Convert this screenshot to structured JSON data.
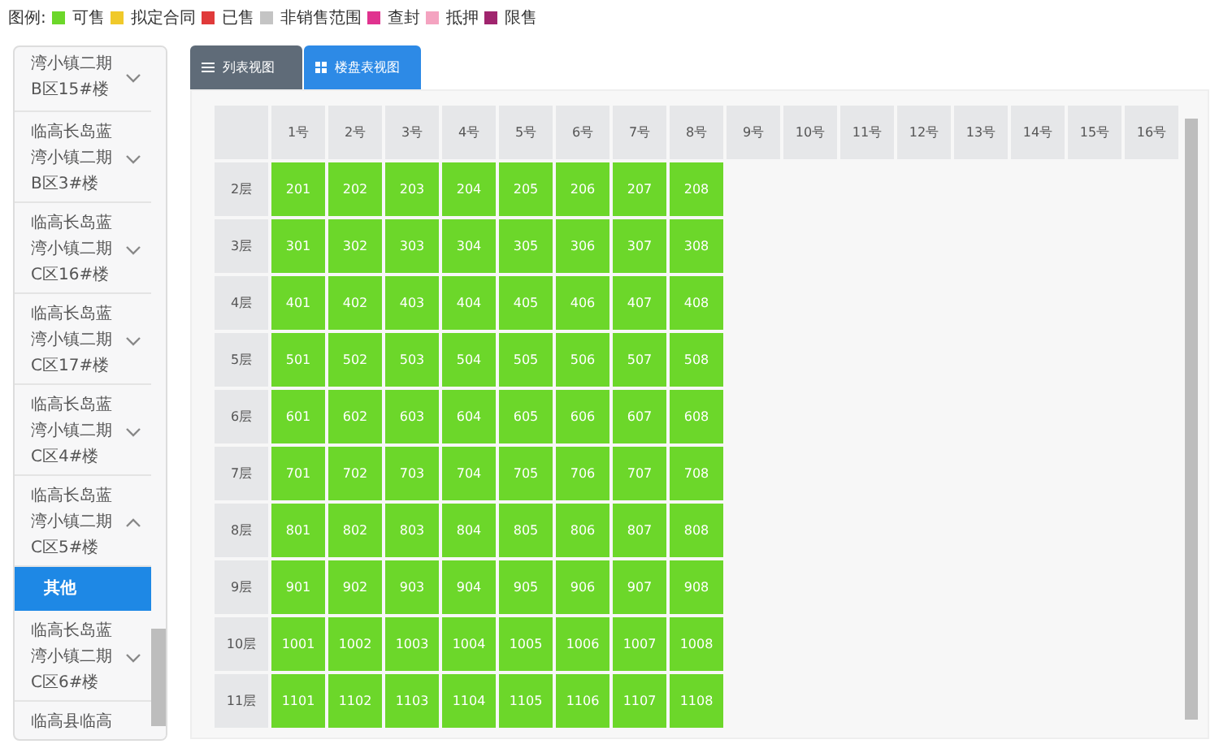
{
  "legend": {
    "title": "图例:",
    "items": [
      {
        "label": "可售",
        "color": "#6cd72a"
      },
      {
        "label": "拟定合同",
        "color": "#f0c92a"
      },
      {
        "label": "已售",
        "color": "#e03a3a"
      },
      {
        "label": "非销售范围",
        "color": "#c4c4c4"
      },
      {
        "label": "查封",
        "color": "#e0338f"
      },
      {
        "label": "抵押",
        "color": "#f4a3c0"
      },
      {
        "label": "限售",
        "color": "#a0256e"
      }
    ]
  },
  "sidebar": {
    "items": [
      {
        "kind": "group",
        "text": "湾小镇二期B区15#楼",
        "expanded": false
      },
      {
        "kind": "group",
        "text": "临高长岛蓝湾小镇二期B区3#楼",
        "expanded": false
      },
      {
        "kind": "group",
        "text": "临高长岛蓝湾小镇二期C区16#楼",
        "expanded": false
      },
      {
        "kind": "group",
        "text": "临高长岛蓝湾小镇二期C区17#楼",
        "expanded": false
      },
      {
        "kind": "group",
        "text": "临高长岛蓝湾小镇二期C区4#楼",
        "expanded": false
      },
      {
        "kind": "group",
        "text": "临高长岛蓝湾小镇二期C区5#楼",
        "expanded": true
      },
      {
        "kind": "sub",
        "text": "其他",
        "selected": true
      },
      {
        "kind": "group",
        "text": "临高长岛蓝湾小镇二期C区6#楼",
        "expanded": false
      },
      {
        "kind": "group",
        "text": "临高县临高"
      }
    ]
  },
  "tabs": [
    {
      "label": "列表视图",
      "selected": false
    },
    {
      "label": "楼盘表视图",
      "selected": true
    }
  ],
  "table": {
    "columns": [
      "1号",
      "2号",
      "3号",
      "4号",
      "5号",
      "6号",
      "7号",
      "8号",
      "9号",
      "10号",
      "11号",
      "12号",
      "13号",
      "14号",
      "15号",
      "16号"
    ],
    "rows": [
      {
        "floor": "2层",
        "units": [
          {
            "label": "201",
            "kind": "available"
          },
          {
            "label": "202",
            "kind": "available"
          },
          {
            "label": "203",
            "kind": "available"
          },
          {
            "label": "204",
            "kind": "available"
          },
          {
            "label": "205",
            "kind": "available"
          },
          {
            "label": "206",
            "kind": "available"
          },
          {
            "label": "207",
            "kind": "available"
          },
          {
            "label": "208",
            "kind": "available"
          }
        ]
      },
      {
        "floor": "3层",
        "units": [
          {
            "label": "301",
            "kind": "available"
          },
          {
            "label": "302",
            "kind": "available"
          },
          {
            "label": "303",
            "kind": "available"
          },
          {
            "label": "304",
            "kind": "available"
          },
          {
            "label": "305",
            "kind": "available"
          },
          {
            "label": "306",
            "kind": "available"
          },
          {
            "label": "307",
            "kind": "available"
          },
          {
            "label": "308",
            "kind": "available"
          }
        ]
      },
      {
        "floor": "4层",
        "units": [
          {
            "label": "401",
            "kind": "available"
          },
          {
            "label": "402",
            "kind": "available"
          },
          {
            "label": "403",
            "kind": "available"
          },
          {
            "label": "404",
            "kind": "available"
          },
          {
            "label": "405",
            "kind": "available"
          },
          {
            "label": "406",
            "kind": "available"
          },
          {
            "label": "407",
            "kind": "available"
          },
          {
            "label": "408",
            "kind": "available"
          }
        ]
      },
      {
        "floor": "5层",
        "units": [
          {
            "label": "501",
            "kind": "available"
          },
          {
            "label": "502",
            "kind": "available"
          },
          {
            "label": "503",
            "kind": "available"
          },
          {
            "label": "504",
            "kind": "available"
          },
          {
            "label": "505",
            "kind": "available"
          },
          {
            "label": "506",
            "kind": "available"
          },
          {
            "label": "507",
            "kind": "available"
          },
          {
            "label": "508",
            "kind": "available"
          }
        ]
      },
      {
        "floor": "6层",
        "units": [
          {
            "label": "601",
            "kind": "available"
          },
          {
            "label": "602",
            "kind": "available"
          },
          {
            "label": "603",
            "kind": "available"
          },
          {
            "label": "604",
            "kind": "available"
          },
          {
            "label": "605",
            "kind": "available"
          },
          {
            "label": "606",
            "kind": "available"
          },
          {
            "label": "607",
            "kind": "available"
          },
          {
            "label": "608",
            "kind": "available"
          }
        ]
      },
      {
        "floor": "7层",
        "units": [
          {
            "label": "701",
            "kind": "available"
          },
          {
            "label": "702",
            "kind": "available"
          },
          {
            "label": "703",
            "kind": "available"
          },
          {
            "label": "704",
            "kind": "available"
          },
          {
            "label": "705",
            "kind": "available"
          },
          {
            "label": "706",
            "kind": "available"
          },
          {
            "label": "707",
            "kind": "available"
          },
          {
            "label": "708",
            "kind": "available"
          }
        ]
      },
      {
        "floor": "8层",
        "units": [
          {
            "label": "801",
            "kind": "available"
          },
          {
            "label": "802",
            "kind": "available"
          },
          {
            "label": "803",
            "kind": "available"
          },
          {
            "label": "804",
            "kind": "available"
          },
          {
            "label": "805",
            "kind": "available"
          },
          {
            "label": "806",
            "kind": "available"
          },
          {
            "label": "807",
            "kind": "available"
          },
          {
            "label": "808",
            "kind": "available"
          }
        ]
      },
      {
        "floor": "9层",
        "units": [
          {
            "label": "901",
            "kind": "available"
          },
          {
            "label": "902",
            "kind": "available"
          },
          {
            "label": "903",
            "kind": "available"
          },
          {
            "label": "904",
            "kind": "available"
          },
          {
            "label": "905",
            "kind": "available"
          },
          {
            "label": "906",
            "kind": "available"
          },
          {
            "label": "907",
            "kind": "available"
          },
          {
            "label": "908",
            "kind": "available"
          }
        ]
      },
      {
        "floor": "10层",
        "units": [
          {
            "label": "1001",
            "kind": "available"
          },
          {
            "label": "1002",
            "kind": "available"
          },
          {
            "label": "1003",
            "kind": "available"
          },
          {
            "label": "1004",
            "kind": "available"
          },
          {
            "label": "1005",
            "kind": "available"
          },
          {
            "label": "1006",
            "kind": "available"
          },
          {
            "label": "1007",
            "kind": "available"
          },
          {
            "label": "1008",
            "kind": "available"
          }
        ]
      },
      {
        "floor": "11层",
        "units": [
          {
            "label": "1101",
            "kind": "available"
          },
          {
            "label": "1102",
            "kind": "available"
          },
          {
            "label": "1103",
            "kind": "available"
          },
          {
            "label": "1104",
            "kind": "available"
          },
          {
            "label": "1105",
            "kind": "available"
          },
          {
            "label": "1106",
            "kind": "available"
          },
          {
            "label": "1107",
            "kind": "available"
          },
          {
            "label": "1108",
            "kind": "available"
          }
        ]
      }
    ]
  }
}
